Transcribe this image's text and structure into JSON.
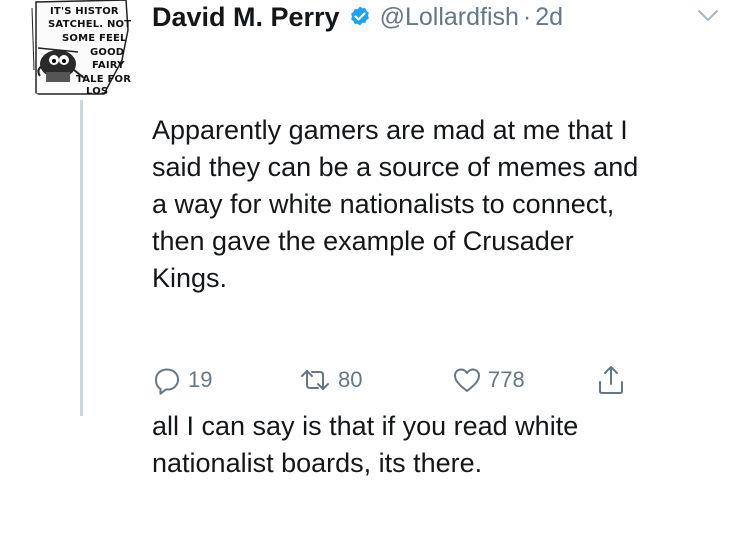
{
  "tweet": {
    "author": {
      "name": "David M. Perry",
      "handle": "@Lollardfish",
      "separator": "·",
      "time": "2d",
      "verified": true,
      "verified_icon": "verified-badge-icon",
      "verified_color": "#1da1f2",
      "avatar": {
        "lines": [
          "IT'S HISTOR",
          "SATCHEL. NOT",
          "SOME FEEL",
          "GOOD",
          "FAIRY",
          "TALE FOR",
          "LOS"
        ]
      }
    },
    "text": {
      "paragraph1": "Apparently gamers are mad at me that I\nsaid they can be a source of memes and\na way for white nationalists to connect,\nthen gave the example of Crusader\nKings.",
      "paragraph2": "all I can say is that if you read white\nnationalist boards, its there."
    },
    "actions": {
      "reply": {
        "icon": "reply-icon",
        "count": "19"
      },
      "retweet": {
        "icon": "retweet-icon",
        "count": "80"
      },
      "like": {
        "icon": "heart-icon",
        "count": "778"
      },
      "share": {
        "icon": "share-icon"
      }
    },
    "menu_icon": "chevron-down-icon",
    "colors": {
      "text": "#14171a",
      "secondary": "#657786",
      "thread_line": "#ccd6dd"
    }
  }
}
